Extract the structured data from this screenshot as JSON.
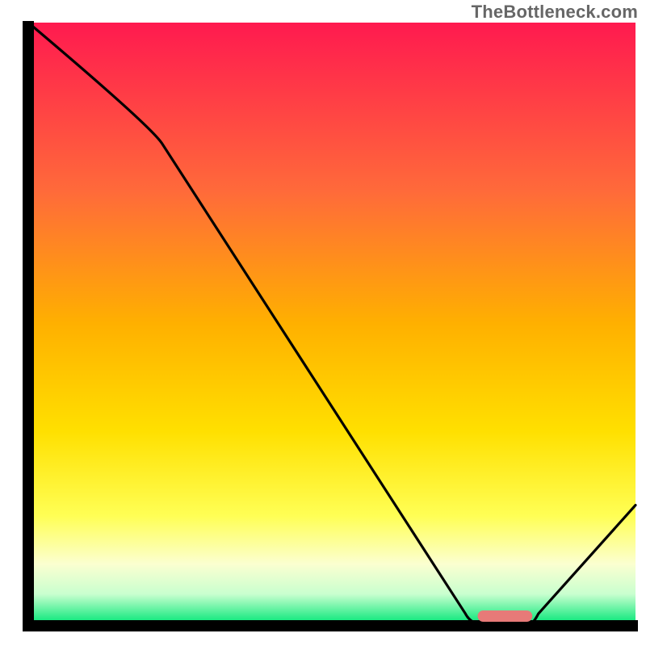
{
  "watermark": "TheBottleneck.com",
  "colors": {
    "axis": "#000000",
    "curve": "#000000",
    "marker_fill": "#e77a78",
    "marker_stroke": "#d96563",
    "grad_top": "#ff1a4f",
    "grad_mid_upper": "#ff8b2e",
    "grad_mid": "#ffd400",
    "grad_lower_yellow": "#ffff66",
    "grad_pale": "#ecffdc",
    "grad_green": "#00e676"
  },
  "chart_data": {
    "type": "line",
    "title": "",
    "xlabel": "",
    "ylabel": "",
    "xlim": [
      0,
      100
    ],
    "ylim": [
      0,
      100
    ],
    "x": [
      0,
      22,
      72,
      76,
      82,
      100
    ],
    "values": [
      100,
      80,
      2,
      0,
      0,
      20
    ],
    "optimum_marker": {
      "x_start": 74,
      "x_end": 83,
      "y": 0
    },
    "gradient_stops": [
      {
        "offset": 0.0,
        "color": "#ff1a4f"
      },
      {
        "offset": 0.28,
        "color": "#ff6a3a"
      },
      {
        "offset": 0.5,
        "color": "#ffb000"
      },
      {
        "offset": 0.68,
        "color": "#ffe000"
      },
      {
        "offset": 0.82,
        "color": "#ffff55"
      },
      {
        "offset": 0.9,
        "color": "#fbffd0"
      },
      {
        "offset": 0.95,
        "color": "#c9ffcf"
      },
      {
        "offset": 1.0,
        "color": "#00e676"
      }
    ]
  }
}
